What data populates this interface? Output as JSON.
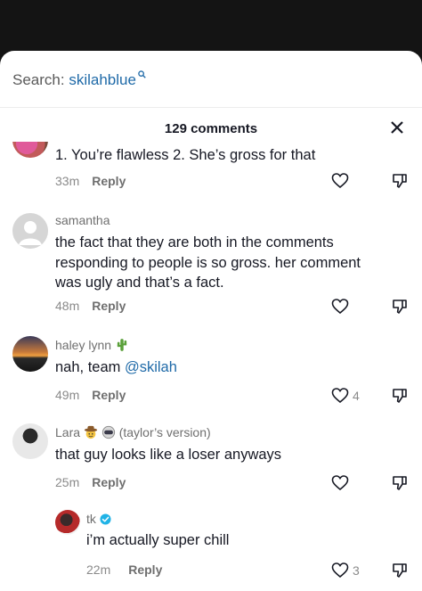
{
  "search": {
    "prefix": "Search:",
    "term": "skilahblue"
  },
  "header": {
    "count_label": "129 comments"
  },
  "comments": [
    {
      "text": "1. You’re flawless 2. She’s gross for that",
      "time": "33m",
      "reply": "Reply"
    },
    {
      "username": "samantha",
      "text": "the fact that they are both in the comments responding to people is so gross. her comment was ugly and that’s a fact.",
      "time": "48m",
      "reply": "Reply"
    },
    {
      "username": "haley lynn",
      "text": "nah, team ",
      "mention": "@skilah",
      "time": "49m",
      "reply": "Reply",
      "likes": "4"
    },
    {
      "username": "Lara",
      "username_suffix": "(taylor’s version)",
      "text": "that guy looks like a loser anyways",
      "time": "25m",
      "reply": "Reply"
    },
    {
      "username": "tk",
      "verified": true,
      "text": "i’m actually super chill",
      "time": "22m",
      "reply": "Reply",
      "likes": "3"
    }
  ],
  "colors": {
    "accent": "#1f6aa8",
    "verified": "#20b3e6",
    "backdrop": "#141414"
  }
}
